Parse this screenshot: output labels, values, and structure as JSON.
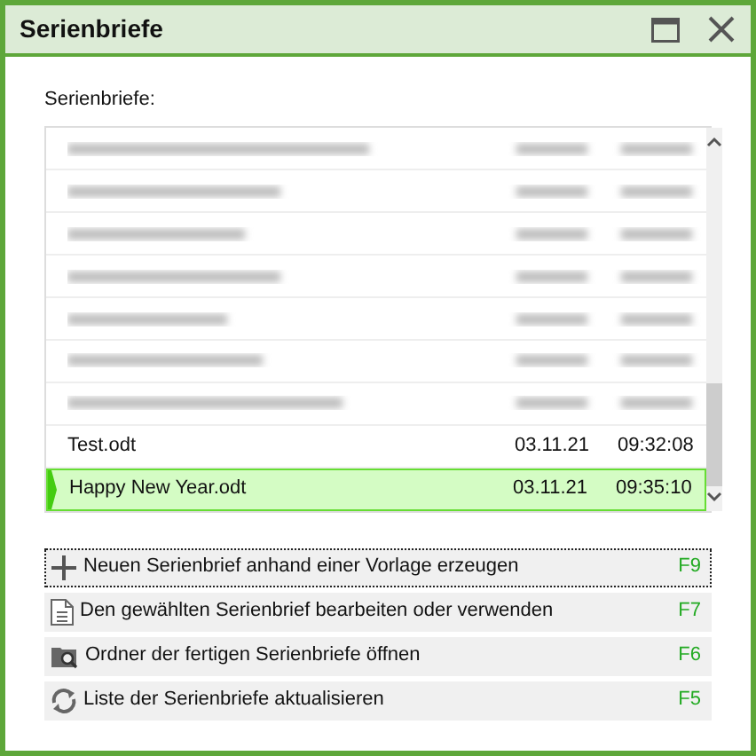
{
  "window": {
    "title": "Serienbriefe"
  },
  "list": {
    "label": "Serienbriefe:",
    "rows": [
      {
        "kind": "blurred",
        "selected": false
      },
      {
        "kind": "blurred",
        "selected": false
      },
      {
        "kind": "blurred",
        "selected": false
      },
      {
        "kind": "blurred",
        "selected": false
      },
      {
        "kind": "blurred",
        "selected": false
      },
      {
        "kind": "blurred",
        "selected": false
      },
      {
        "kind": "blurred",
        "selected": false
      },
      {
        "kind": "file",
        "name": "Test.odt",
        "date": "03.11.21",
        "time": "09:32:08",
        "selected": false
      },
      {
        "kind": "file",
        "name": "Happy New Year.odt",
        "date": "03.11.21",
        "time": "09:35:10",
        "selected": true
      }
    ]
  },
  "actions": [
    {
      "kind": "new",
      "label": "Neuen Serienbrief anhand einer Vorlage erzeugen",
      "key": "F9",
      "focused": true
    },
    {
      "kind": "edit",
      "label": "Den gewählten Serienbrief bearbeiten oder verwenden",
      "key": "F7",
      "focused": false
    },
    {
      "kind": "folder",
      "label": "Ordner der fertigen Serienbriefe öffnen",
      "key": "F6",
      "focused": false
    },
    {
      "kind": "refresh",
      "label": "Liste der Serienbriefe aktualisieren",
      "key": "F5",
      "focused": false
    }
  ]
}
